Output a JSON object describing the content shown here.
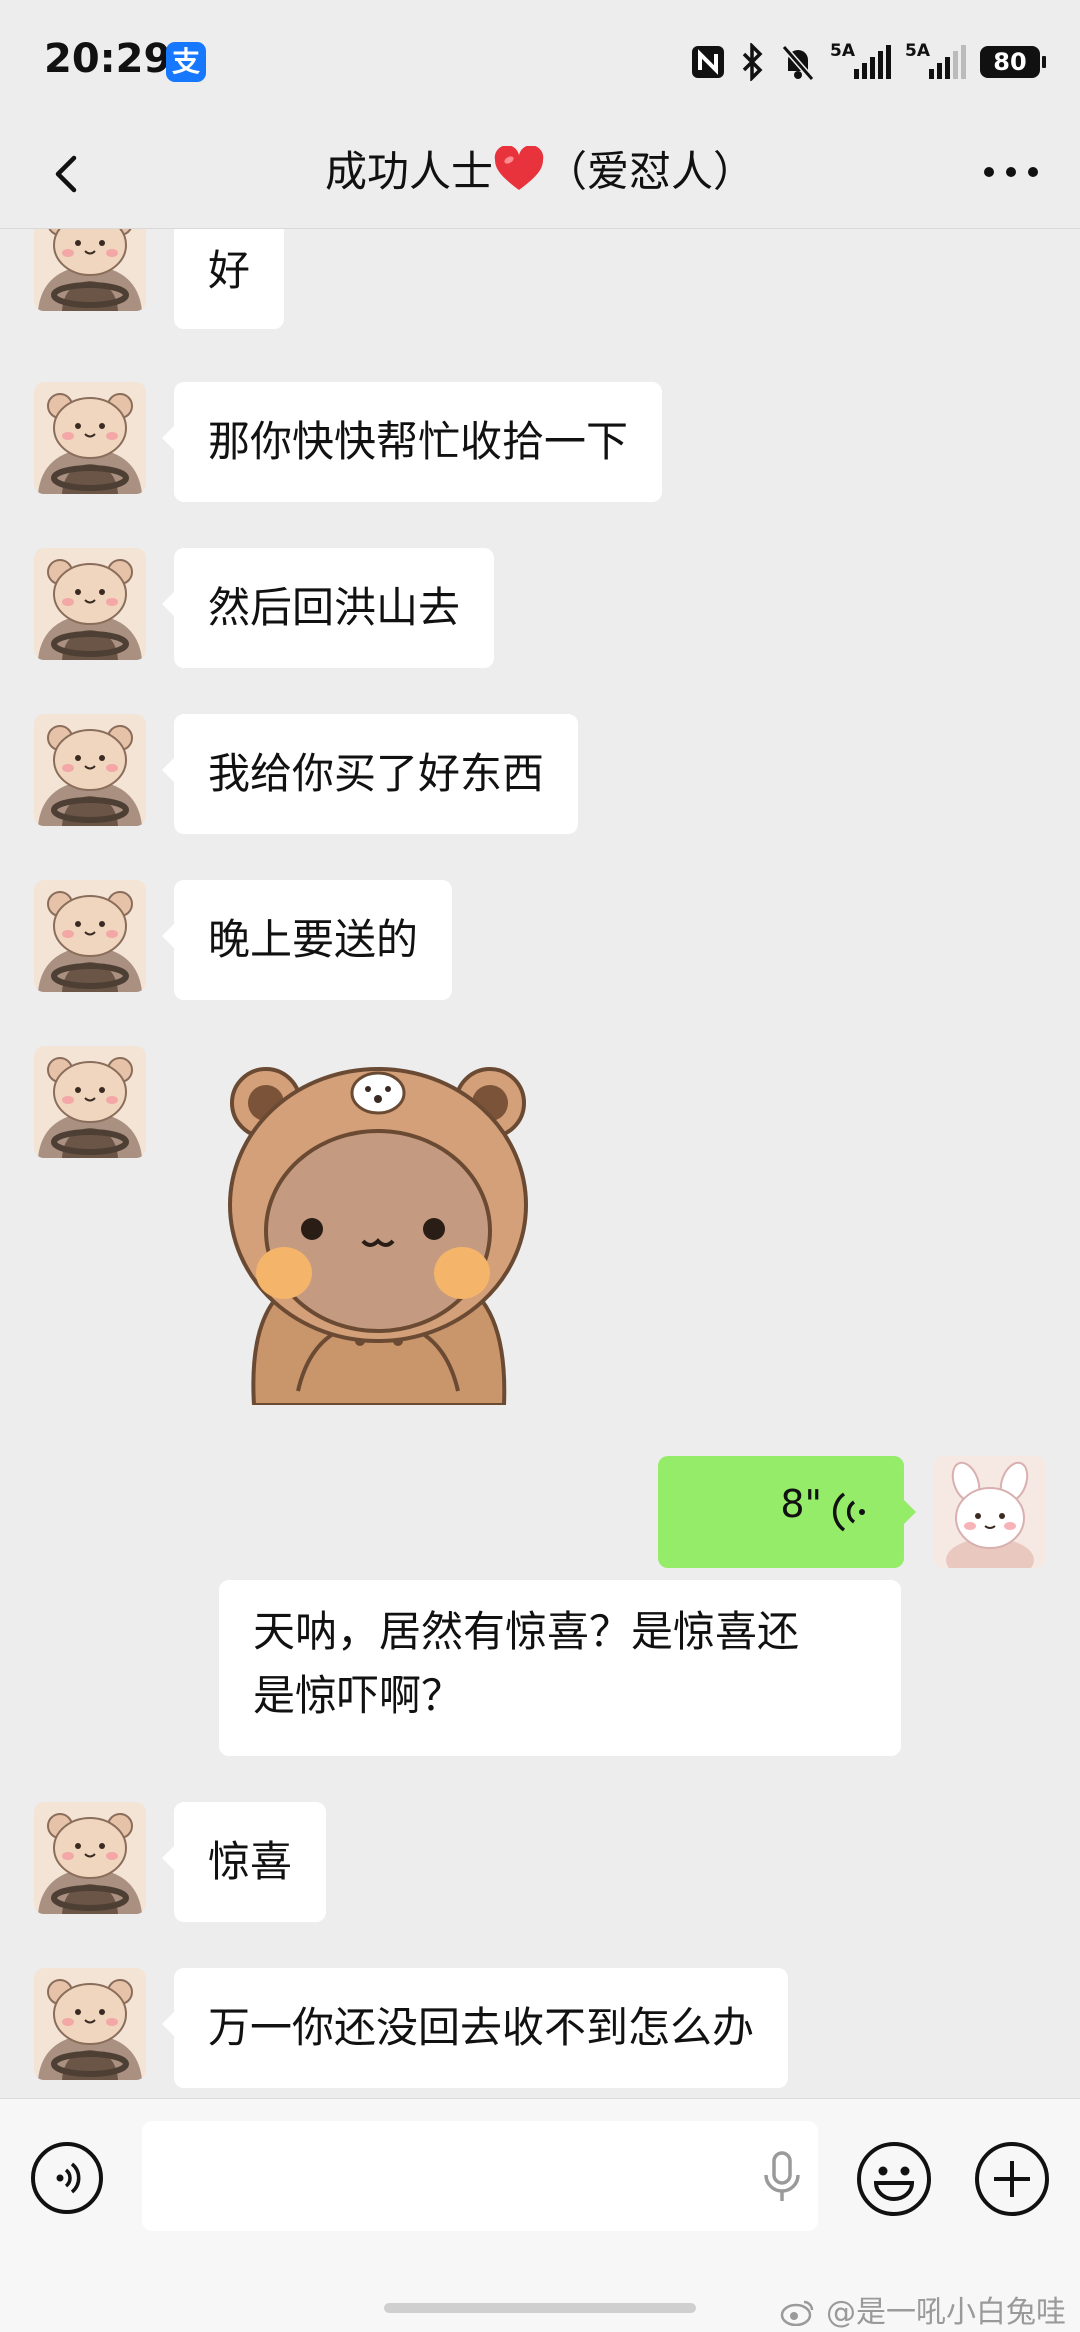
{
  "status_bar": {
    "time": "20:29",
    "app_badge": "支",
    "signal1_label": "5A",
    "signal2_label": "5A",
    "battery": "80",
    "icons": [
      "nfc-icon",
      "bluetooth-icon",
      "silent-bell-icon",
      "signal-icon",
      "signal-icon",
      "battery-icon"
    ]
  },
  "nav": {
    "title_prefix": "成功人士",
    "title_suffix": "（爱怼人）",
    "back_icon": "chevron-left-icon",
    "more_icon": "more-dots-icon"
  },
  "messages": [
    {
      "side": "left",
      "type": "text",
      "text": "好"
    },
    {
      "side": "left",
      "type": "text",
      "text": "那你快快帮忙收拾一下"
    },
    {
      "side": "left",
      "type": "text",
      "text": "然后回洪山去"
    },
    {
      "side": "left",
      "type": "text",
      "text": "我给你买了好东西"
    },
    {
      "side": "left",
      "type": "text",
      "text": "晚上要送的"
    },
    {
      "side": "left",
      "type": "sticker",
      "sticker": "bear-hoodie-sticker"
    },
    {
      "side": "right",
      "type": "voice",
      "duration": "8\""
    },
    {
      "side": "right",
      "type": "transcript",
      "line1": "天呐，居然有惊喜？是惊喜还",
      "line2": "是惊吓啊？"
    },
    {
      "side": "left",
      "type": "text",
      "text": "惊喜"
    },
    {
      "side": "left",
      "type": "text",
      "text": "万一你还没回去收不到怎么办"
    }
  ],
  "bottom": {
    "voice_toggle_icon": "voice-mode-icon",
    "mic_icon": "microphone-icon",
    "emoji_icon": "emoji-icon",
    "plus_icon": "plus-icon",
    "watermark": "@是一吼小白兔哇"
  },
  "colors": {
    "background": "#ededed",
    "bubble_in": "#ffffff",
    "bubble_out": "#95ec69",
    "heart": "#e8333c"
  }
}
